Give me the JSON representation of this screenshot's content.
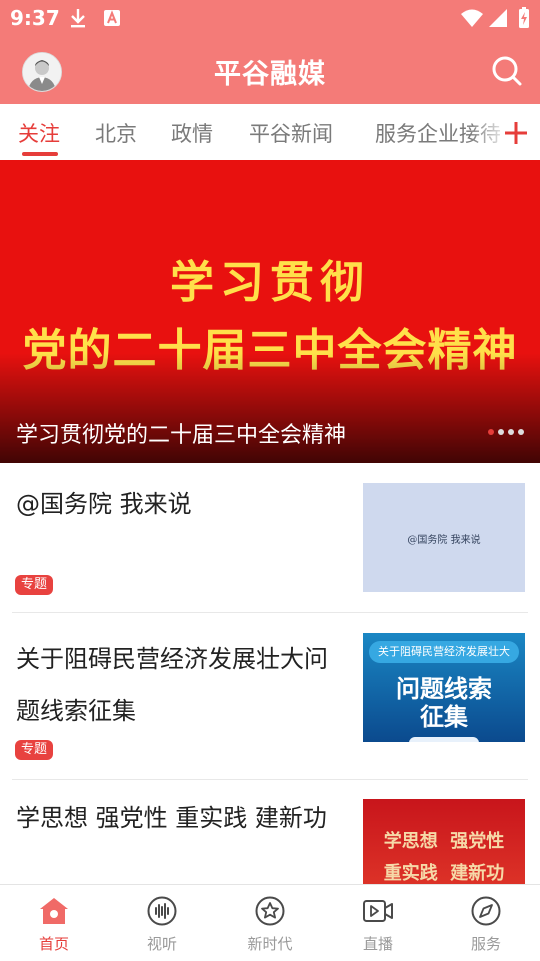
{
  "status_bar": {
    "time": "9:37",
    "icons": [
      "download-icon",
      "font-a-icon",
      "wifi-icon",
      "signal-icon",
      "battery-charging-icon"
    ]
  },
  "header": {
    "title": "平谷融媒",
    "avatar_icon": "user-avatar-icon",
    "search_icon": "search-icon"
  },
  "tabs": [
    {
      "label": "关注",
      "active": true
    },
    {
      "label": "北京",
      "active": false
    },
    {
      "label": "政情",
      "active": false
    },
    {
      "label": "平谷新闻",
      "active": false
    },
    {
      "label": "服务企业接待",
      "active": false
    }
  ],
  "add_tab_icon": "plus-icon",
  "banner": {
    "image_text_line1": "学习贯彻",
    "image_text_line2": "党的二十届三中全会精神",
    "caption": "学习贯彻党的二十届三中全会精神",
    "page_count": 4,
    "current_page": 1
  },
  "articles": [
    {
      "title": "@国务院 我来说",
      "tag": "专题",
      "thumb_text": "@国务院  我来说"
    },
    {
      "title": "关于阻碍民营经济发展壮大问题线索征集",
      "tag": "专题",
      "thumb_header": "关于阻碍民营经济发展壮大",
      "thumb_line1": "问题线索",
      "thumb_line2": "征集"
    },
    {
      "title": "学思想 强党性 重实践 建新功",
      "thumb_line1": "学思想  强党性",
      "thumb_line2": "重实践  建新功"
    }
  ],
  "bottom_nav": [
    {
      "label": "首页",
      "icon": "home-icon",
      "active": true
    },
    {
      "label": "视听",
      "icon": "audio-wave-icon",
      "active": false
    },
    {
      "label": "新时代",
      "icon": "star-badge-icon",
      "active": false
    },
    {
      "label": "直播",
      "icon": "video-camera-icon",
      "active": false
    },
    {
      "label": "服务",
      "icon": "compass-icon",
      "active": false
    }
  ],
  "colors": {
    "brand": "#f47b78",
    "accent": "#e63d3a",
    "banner_red": "#e8110f",
    "banner_gold": "#ffe04a",
    "tag_red": "#e8423f"
  }
}
